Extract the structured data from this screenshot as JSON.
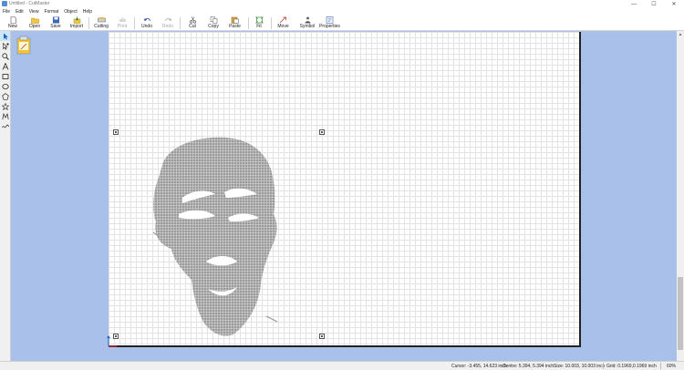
{
  "window": {
    "title": "Untitled - CutMaster",
    "minimize": "—",
    "maximize": "☐",
    "close": "✕"
  },
  "menu": [
    "File",
    "Edit",
    "View",
    "Format",
    "Object",
    "Help"
  ],
  "toolbar": {
    "new": "New",
    "open": "Open",
    "save": "Save",
    "import": "Import",
    "cutting": "Cutting",
    "print": "Print",
    "undo": "Undo",
    "redo": "Redo",
    "cut": "Cut",
    "copy": "Copy",
    "paste": "Paste",
    "fit": "Fit",
    "move": "Move",
    "symbol": "Symbol",
    "properties": "Properties"
  },
  "tools": [
    "select-arrow-icon",
    "node-edit-icon",
    "zoom-icon",
    "text-icon",
    "rectangle-icon",
    "ellipse-icon",
    "polygon-icon",
    "star-icon",
    "bezier-icon",
    "freehand-icon"
  ],
  "colors": {
    "workspace": "#a9c0ea",
    "grid": "#e3e3e3",
    "artwork": "#9a9a9a",
    "accent": "#1565c0"
  },
  "status": {
    "cursor": "Cursor: -3.455, 14.623 inch",
    "center": "Centre: 5.394, 5.394 inch",
    "size": "Size: 10.003, 10.003 inch",
    "grid": "Grid: 0.1969,0.1969 inch",
    "zoom": "60%"
  }
}
